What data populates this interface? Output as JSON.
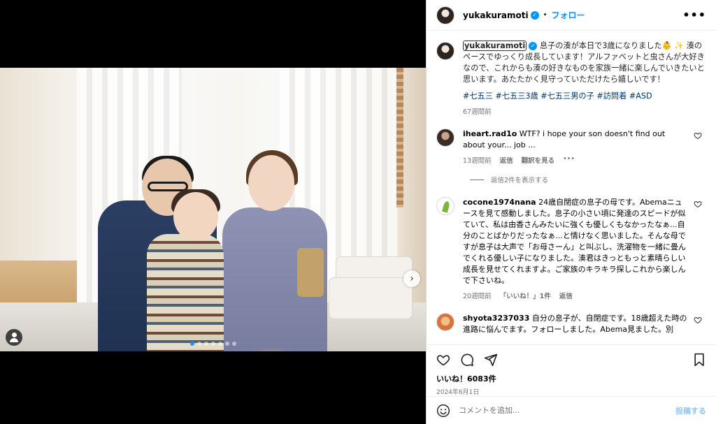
{
  "header": {
    "username": "yukakuramoti",
    "separator": "•",
    "follow_label": "フォロー",
    "more_icon": "more-horizontal-icon"
  },
  "caption": {
    "username": "yukakuramoti",
    "text": "息子の湊が本日で3歳になりました👶 ✨ 湊のペースでゆっくり成長しています！アルファベットと虫さんが大好きなので、これからも湊の好きなものを家族一緒に楽しんでいきたいと思います。あたたかく見守っていただけたら嬉しいです！",
    "hashtags": "#七五三 #七五三3歳 #七五三男の子 #訪問着 #ASD",
    "time": "67週間前"
  },
  "comments": [
    {
      "username": "iheart.rad1o",
      "text": "WTF? i hope your son doesn't find out about your... job ...",
      "time": "13週間前",
      "reply_label": "返信",
      "translate_label": "翻訳を見る",
      "more": "•••",
      "replies_toggle": "返信2件を表示する"
    },
    {
      "username": "cocone1974nana",
      "text": "24歳自閉症の息子の母です。Abemaニュースを見て感動しました。息子の小さい頃に発達のスピードが似ていて、私は由香さんみたいに強くも優しくもなかったなぁ...自分のことばかりだったなぁ...と情けなく思いました。そんな母ですが息子は大声で「お母さーん」と叫ぶし、洗濯物を一緒に畳んでくれる優しい子になりました。湊君はきっともっと素晴らしい成長を見せてくれますよ。ご家族のキラキラ探しこれから楽しんで下さいね。",
      "time": "20週間前",
      "likes_label": "「いいね！」1件",
      "reply_label": "返信"
    },
    {
      "username": "shyota3237033",
      "text": "自分の息子が、自閉症です。18歳超えた時の進路に悩んでます。フォローしました。Abema見ました。別"
    }
  ],
  "actions": {
    "icons": [
      "heart-icon",
      "comment-icon",
      "share-icon",
      "bookmark-icon"
    ],
    "likes": "いいね！6083件",
    "date": "2024年6月1日"
  },
  "composer": {
    "emoji_icon": "emoji-icon",
    "placeholder": "コメントを追加...",
    "post_label": "投稿する"
  },
  "carousel": {
    "slides": 7,
    "active": 1
  },
  "colors": {
    "link": "#00376b",
    "accent": "#0095f6",
    "muted": "#737373",
    "post_disabled": "#8fc8f5"
  }
}
